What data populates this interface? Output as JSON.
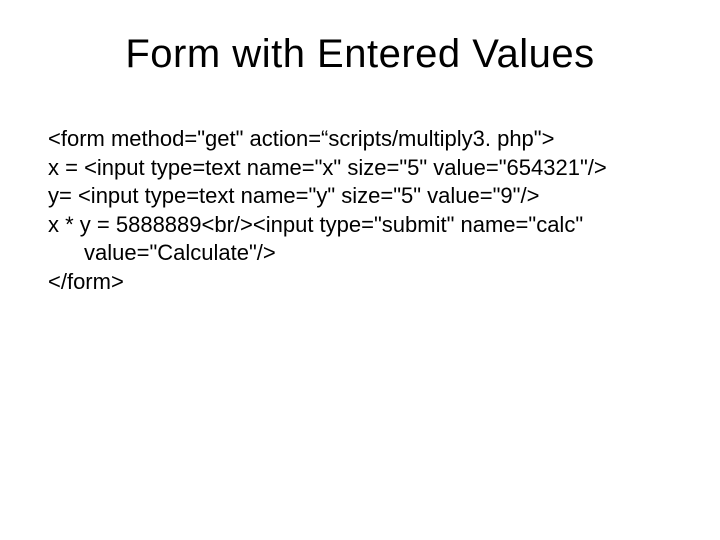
{
  "title": "Form with Entered Values",
  "code": {
    "l1": "<form method=\"get\" action=“scripts/multiply3. php\">",
    "l2": "x = <input type=text name=\"x\" size=\"5\" value=\"654321\"/>",
    "l3": "y=  <input type=text name=\"y\" size=\"5\" value=\"9\"/>",
    "l4": "x * y = 5888889<br/><input type=\"submit\" name=\"calc\"",
    "l5": "value=\"Calculate\"/>",
    "l6": "</form>"
  }
}
